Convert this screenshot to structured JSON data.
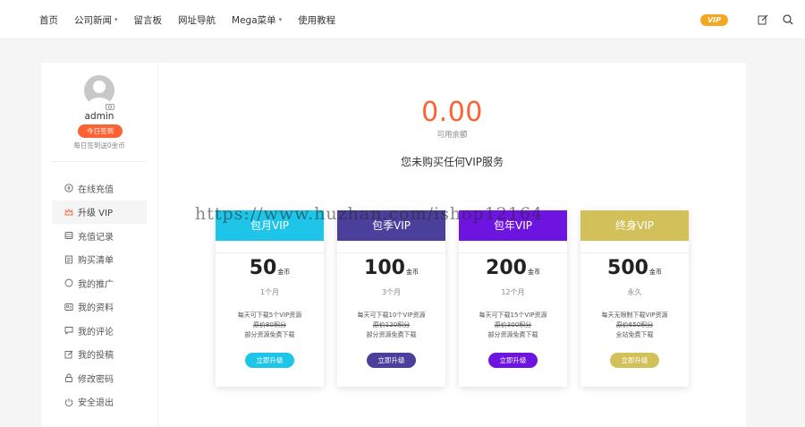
{
  "nav": {
    "items": [
      {
        "label": "首页",
        "has_caret": false
      },
      {
        "label": "公司新闻",
        "has_caret": true
      },
      {
        "label": "留言板",
        "has_caret": false
      },
      {
        "label": "网址导航",
        "has_caret": false
      },
      {
        "label": "Mega菜单",
        "has_caret": true
      },
      {
        "label": "使用教程",
        "has_caret": false
      }
    ],
    "vip_label": "VIP",
    "icons": [
      "edit-icon",
      "search-icon"
    ]
  },
  "sidebar": {
    "username": "admin",
    "signin_label": "今日签到",
    "signin_note": "每日签到送0金币",
    "menu": [
      {
        "label": "在线充值",
        "icon": "coin-icon"
      },
      {
        "label": "升级 VIP",
        "icon": "crown-icon",
        "active": true
      },
      {
        "label": "充值记录",
        "icon": "database-icon"
      },
      {
        "label": "购买清单",
        "icon": "list-icon"
      },
      {
        "label": "我的推广",
        "icon": "circle-icon"
      },
      {
        "label": "我的资料",
        "icon": "profile-icon"
      },
      {
        "label": "我的评论",
        "icon": "comment-icon"
      },
      {
        "label": "我的投稿",
        "icon": "edit-icon"
      },
      {
        "label": "修改密码",
        "icon": "lock-icon"
      },
      {
        "label": "安全退出",
        "icon": "power-icon"
      }
    ]
  },
  "main": {
    "balance": "0.00",
    "balance_label": "可用余额",
    "vip_status": "您未购买任何VIP服务",
    "plans": [
      {
        "name": "包月VIP",
        "price": "50",
        "unit": "金币",
        "period": "1个月",
        "feature1": "每天可下载5个VIP资源",
        "feature2": "原价80积分",
        "feature3": "部分资源免费下载",
        "button": "立即升级",
        "head_color": "#1ec5e8",
        "btn_color": "#1ec5e8"
      },
      {
        "name": "包季VIP",
        "price": "100",
        "unit": "金币",
        "period": "3个月",
        "feature1": "每天可下载10个VIP资源",
        "feature2": "原价120积分",
        "feature3": "部分资源免费下载",
        "button": "立即升级",
        "head_color": "#4a3f9a",
        "btn_color": "#4a3f9a"
      },
      {
        "name": "包年VIP",
        "price": "200",
        "unit": "金币",
        "period": "12个月",
        "feature1": "每天可下载15个VIP资源",
        "feature2": "原价300积分",
        "feature3": "部分资源免费下载",
        "button": "立即升级",
        "head_color": "#6e14e0",
        "btn_color": "#6e14e0"
      },
      {
        "name": "终身VIP",
        "price": "500",
        "unit": "金币",
        "period": "永久",
        "feature1": "每天无限制下载VIP资源",
        "feature2": "原价650积分",
        "feature3": "全站免费下载",
        "button": "立即升级",
        "head_color": "#d2c15a",
        "btn_color": "#d2c15a"
      }
    ]
  },
  "watermark": "https://www.huzhan.com/ishop12164"
}
